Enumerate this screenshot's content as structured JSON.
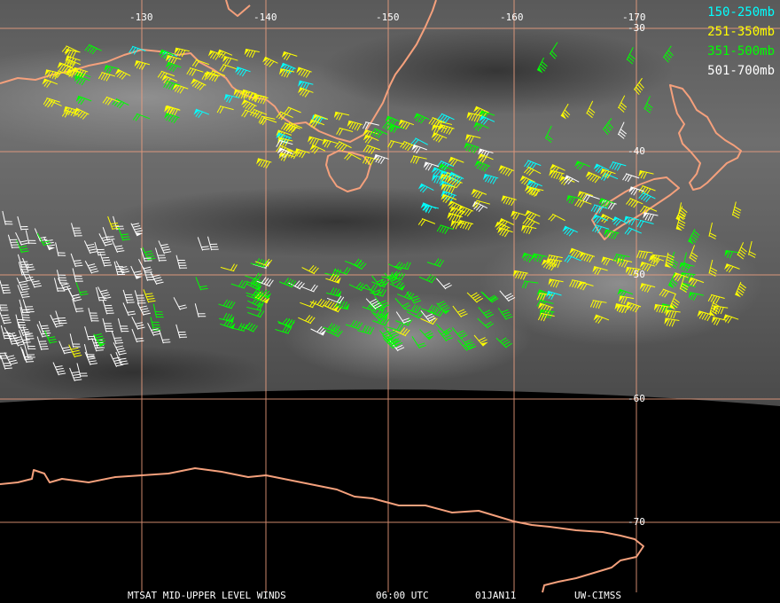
{
  "longitude_labels": [
    "-130",
    "-140",
    "-150",
    "-160",
    "-170"
  ],
  "latitude_labels": [
    "-30",
    "-40",
    "-50",
    "-60",
    "-70"
  ],
  "legend": [
    {
      "label": "150-250mb",
      "color": "#00ffff"
    },
    {
      "label": "251-350mb",
      "color": "#ffff00"
    },
    {
      "label": "351-500mb",
      "color": "#00ff00"
    },
    {
      "label": "501-700mb",
      "color": "#ffffff"
    }
  ],
  "footer": {
    "product": "MTSAT MID-UPPER LEVEL WINDS",
    "time": "06:00 UTC",
    "date": "01JAN11",
    "source": "UW-CIMSS"
  },
  "colors": {
    "grid": "#f0a080",
    "coast": "#f4a07c",
    "background": "#000000"
  }
}
